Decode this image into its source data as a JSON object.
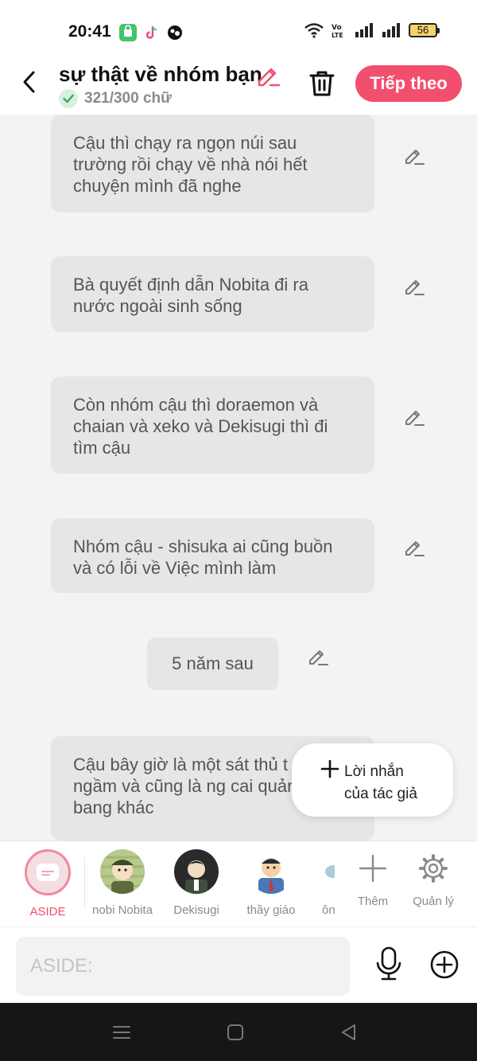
{
  "status_bar": {
    "time": "20:41",
    "battery": "56",
    "icons": [
      "shop-icon",
      "tiktok-icon",
      "vpn-icon",
      "wifi-icon",
      "volte-icon",
      "signal-icon",
      "signal-icon",
      "battery-icon"
    ]
  },
  "header": {
    "title": "sự thật về nhóm bạn",
    "word_count": "321/300 chữ",
    "next_label": "Tiếp theo",
    "accent_color": "#f24f6f"
  },
  "messages": [
    {
      "text": "Cậu thì chạy ra ngọn núi sau trường rồi chạy về nhà nói hết chuyện mình đã nghe"
    },
    {
      "text": "Bà quyết định dẫn Nobita đi ra nước ngoài sinh sống"
    },
    {
      "text": "Còn nhóm cậu thì doraemon và chaian và xeko và Dekisugi thì đi tìm cậu"
    },
    {
      "text": "Nhóm cậu - shisuka ai cũng buồn và có lỗi về Việc mình làm"
    },
    {
      "text": "5 năm sau"
    },
    {
      "text": "Cậu bây giờ là một sát thủ t thế giới ngầm và cũng là ng cai quản các bang khác"
    }
  ],
  "popup": {
    "label_line1": "Lời nhắn",
    "label_line2": "của tác giả"
  },
  "characters": {
    "aside_label": "ASIDE",
    "items": [
      {
        "name": "nobi Nobita"
      },
      {
        "name": "Dekisugi"
      },
      {
        "name": "thầy giáo"
      },
      {
        "name": "ôn"
      }
    ],
    "add_label": "Thêm",
    "manage_label": "Quản lý"
  },
  "input": {
    "placeholder": "ASIDE:"
  }
}
